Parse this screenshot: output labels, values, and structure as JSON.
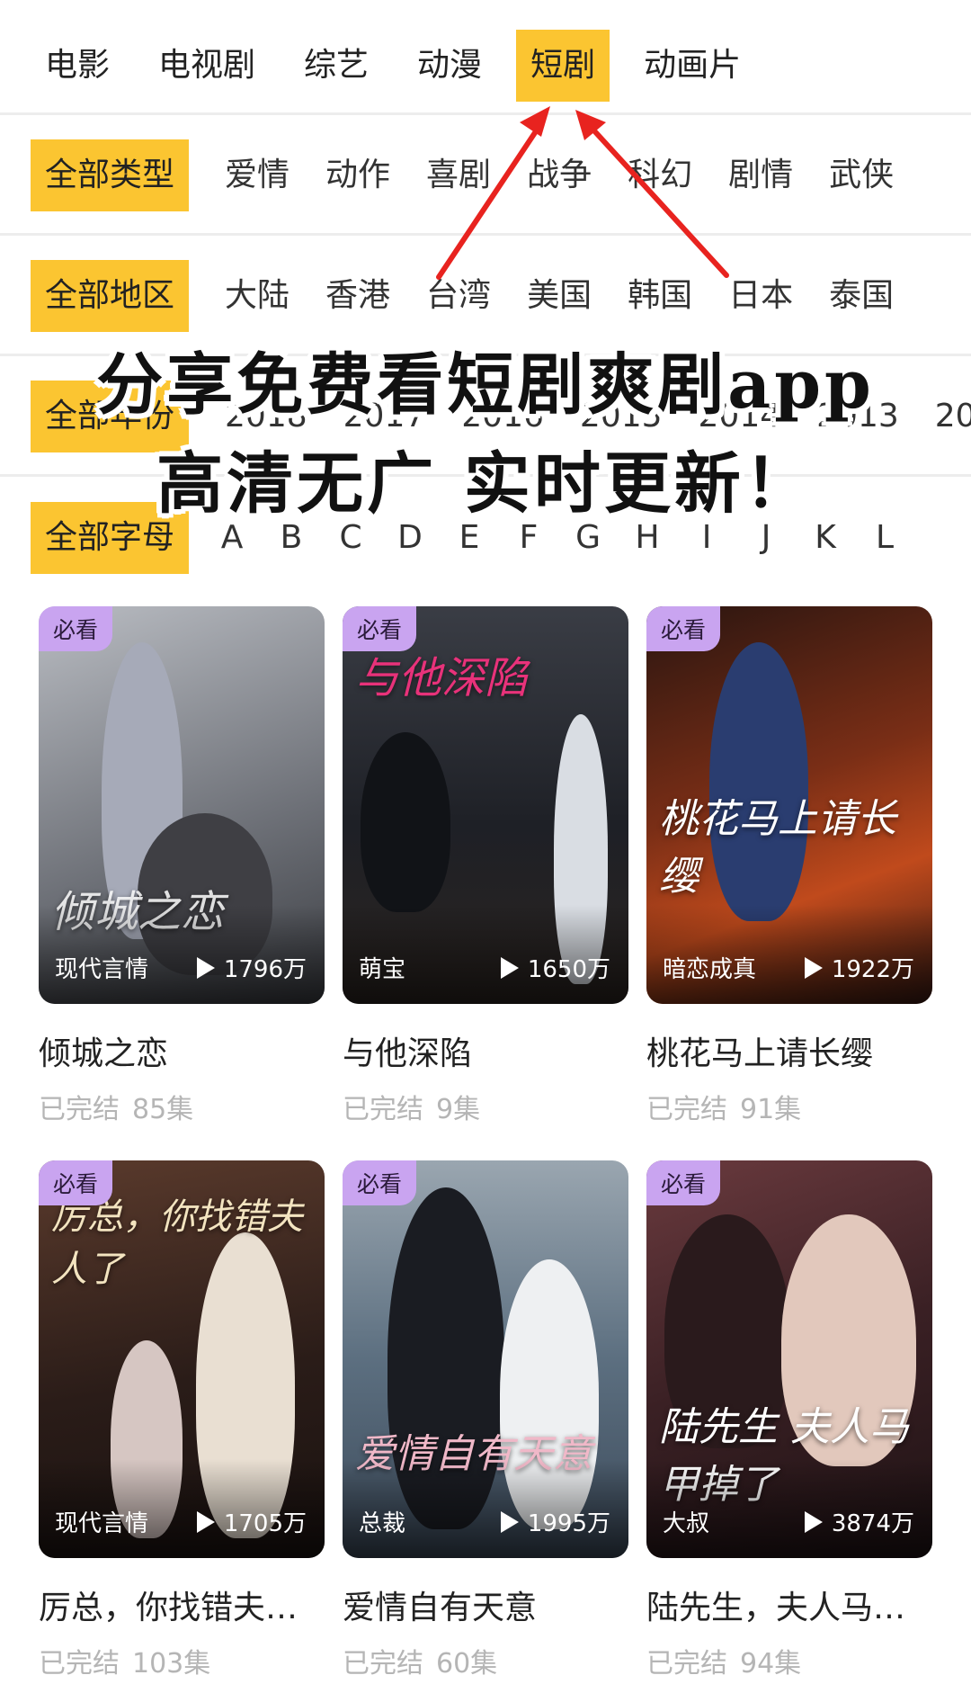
{
  "category_tabs": [
    "电影",
    "电视剧",
    "综艺",
    "动漫",
    "短剧",
    "动画片"
  ],
  "active_category": "短剧",
  "genre": {
    "all": "全部类型",
    "options": [
      "爱情",
      "动作",
      "喜剧",
      "战争",
      "科幻",
      "剧情",
      "武侠"
    ]
  },
  "region": {
    "all": "全部地区",
    "options": [
      "大陆",
      "香港",
      "台湾",
      "美国",
      "韩国",
      "日本",
      "泰国"
    ]
  },
  "year": {
    "all": "全部年份",
    "options": [
      "2018",
      "2017",
      "2016",
      "2015",
      "2014",
      "2013",
      "20"
    ]
  },
  "letter": {
    "all": "全部字母",
    "options": [
      "A",
      "B",
      "C",
      "D",
      "E",
      "F",
      "G",
      "H",
      "I",
      "J",
      "K",
      "L"
    ]
  },
  "annotation": {
    "line1": "分享免费看短剧爽剧app",
    "line2": "高清无广 实时更新！",
    "arrow_color": "#e8231f"
  },
  "accent_color": "#fbc531",
  "badge_color": "#c9a4f0",
  "cards": [
    {
      "badge": "必看",
      "poster_text": "倾城之恋",
      "tag": "现代言情",
      "views": "1796万",
      "title": "倾城之恋",
      "status": "已完结",
      "episodes": "85集",
      "bg": "#8d8f95"
    },
    {
      "badge": "必看",
      "poster_text": "与他深陷",
      "tag": "萌宝",
      "views": "1650万",
      "title": "与他深陷",
      "status": "已完结",
      "episodes": "9集",
      "bg": "#2b2e36"
    },
    {
      "badge": "必看",
      "poster_text": "桃花马上请长缨",
      "tag": "暗恋成真",
      "views": "1922万",
      "title": "桃花马上请长缨",
      "status": "已完结",
      "episodes": "91集",
      "bg": "#5a2418"
    },
    {
      "badge": "必看",
      "poster_text": "厉总，你找错夫人了",
      "tag": "现代言情",
      "views": "1705万",
      "title": "厉总，你找错夫…",
      "status": "已完结",
      "episodes": "103集",
      "bg": "#3a2a25"
    },
    {
      "badge": "必看",
      "poster_text": "爱情自有天意",
      "tag": "总裁",
      "views": "1995万",
      "title": "爱情自有天意",
      "status": "已完结",
      "episodes": "60集",
      "bg": "#5c6f80"
    },
    {
      "badge": "必看",
      "poster_text": "陆先生 夫人马甲掉了",
      "tag": "大叔",
      "views": "3874万",
      "title": "陆先生，夫人马…",
      "status": "已完结",
      "episodes": "94集",
      "bg": "#4a2a2e"
    }
  ]
}
